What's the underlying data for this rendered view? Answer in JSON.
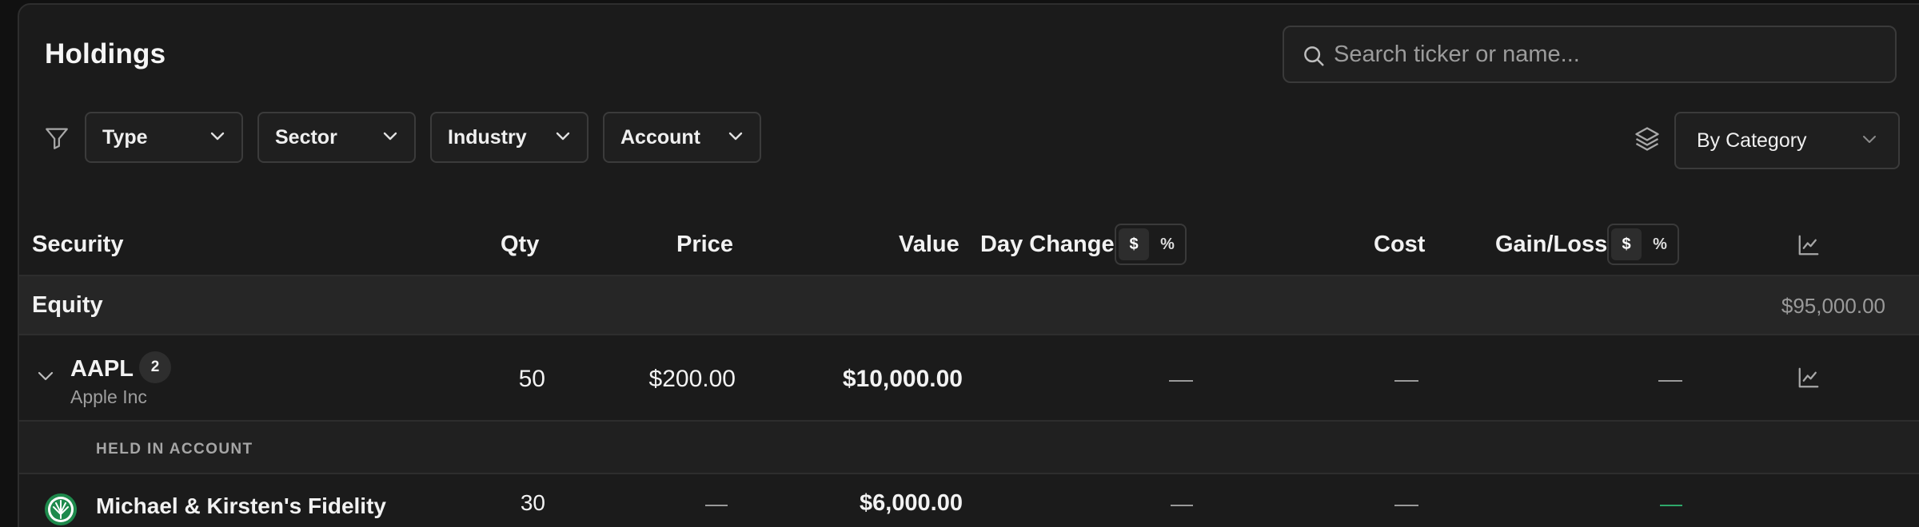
{
  "page": {
    "title": "Holdings"
  },
  "search": {
    "placeholder": "Search ticker or name..."
  },
  "filters": {
    "type_label": "Type",
    "sector_label": "Sector",
    "industry_label": "Industry",
    "account_label": "Account",
    "group_by_value": "By Category"
  },
  "table": {
    "headers": {
      "security": "Security",
      "qty": "Qty",
      "price": "Price",
      "value": "Value",
      "day_change": "Day Change",
      "cost": "Cost",
      "gain_loss": "Gain/Loss"
    },
    "toggles": {
      "dollar": "$",
      "percent": "%"
    },
    "category": {
      "name": "Equity",
      "total": "$95,000.00"
    },
    "holding": {
      "ticker": "AAPL",
      "lot_count": "2",
      "company": "Apple Inc",
      "qty": "50",
      "price": "$200.00",
      "value": "$10,000.00",
      "day_change": "—",
      "cost": "—",
      "gain_loss": "—"
    },
    "held_in_label": "HELD IN ACCOUNT",
    "accounts": [
      {
        "name": "Michael & Kirsten's Fidelity",
        "qty": "30",
        "price": "—",
        "value": "$6,000.00",
        "day_change": "—",
        "cost": "—",
        "gain_loss": "—"
      }
    ]
  },
  "colors": {
    "background": "#1b1b1b",
    "row_highlight": "#262626",
    "border": "#3a3a3a",
    "text_primary": "#f2f2f2",
    "text_muted": "#9e9e9e",
    "gain_positive": "#2ea86a",
    "fidelity_green": "#1e8a4c"
  },
  "icons": {
    "search": "search-icon",
    "filter": "filter-icon",
    "dropdown": "chevron-down-icon",
    "layers": "layers-icon",
    "chart": "chart-line-icon",
    "expand": "chevron-down-icon",
    "account_logo": "fidelity-logo"
  }
}
